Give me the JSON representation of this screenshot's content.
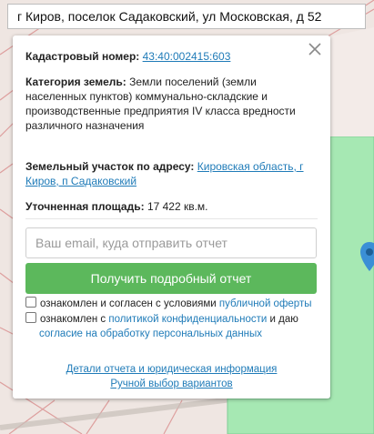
{
  "search": {
    "value": "г Киров, поселок Садаковский, ул Московская, д 52"
  },
  "card": {
    "cadastral": {
      "label": "Кадастровый номер:",
      "value": "43:40:002415:603"
    },
    "category": {
      "label": "Категория земель:",
      "value": "Земли поселений (земли населенных пунктов) коммунально-складские и производственные предприятия IV класса вредности различного назначения"
    },
    "address": {
      "label": "Земельный участок по адресу:",
      "value": "Кировская область, г Киров, п Садаковский"
    },
    "area": {
      "label": "Уточненная площадь:",
      "value": "17 422 кв.м."
    },
    "email_placeholder": "Ваш email, куда отправить отчет",
    "submit_label": "Получить подробный отчет",
    "consent1": {
      "text": "ознакомлен и согласен с условиями",
      "link": "публичной оферты"
    },
    "consent2": {
      "text1": "ознакомлен с",
      "link1": "политикой конфиденциальности",
      "text2": "и даю",
      "link2": "согласие на обработку персональных данных"
    },
    "footer_links": [
      "Детали отчета и юридическая информация",
      "Ручной выбор вариантов"
    ]
  },
  "colors": {
    "accent": "#5cb85c",
    "link": "#1f7bb8",
    "map_green": "#a6e8b3",
    "map_bg": "#efe6e2"
  }
}
